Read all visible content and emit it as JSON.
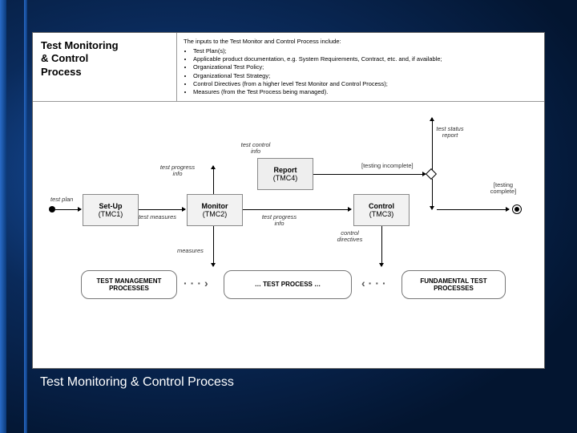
{
  "title": "Test Monitoring\n& Control\nProcess",
  "caption": "Test Monitoring & Control Process",
  "inputs": {
    "lead": "The inputs to the Test Monitor and Control Process include:",
    "items": [
      "Test Plan(s);",
      "Applicable product documentation, e.g. System Requirements, Contract, etc. and, if available;",
      "Organizational Test Policy;",
      "Organizational Test Strategy;",
      "Control Directives (from a higher level Test Monitor and Control Process);",
      "Measures (from the Test Process being managed)."
    ]
  },
  "nodes": {
    "setup": {
      "name": "Set-Up",
      "code": "(TMC1)"
    },
    "monitor": {
      "name": "Monitor",
      "code": "(TMC2)"
    },
    "report": {
      "name": "Report",
      "code": "(TMC4)"
    },
    "control": {
      "name": "Control",
      "code": "(TMC3)"
    }
  },
  "labels": {
    "test_plan": "test plan",
    "test_measures": "test measures",
    "test_progress_info_1": "test progress info",
    "test_control_info": "test control info",
    "test_progress_info_2": "test progress info",
    "test_status_report": "test status report",
    "testing_incomplete": "[testing incomplete]",
    "testing_complete": "[testing complete]",
    "measures": "measures",
    "control_directives": "control directives"
  },
  "rboxes": {
    "tmp": "TEST MANAGEMENT PROCESSES",
    "tp": "… TEST PROCESS …",
    "ftp": "FUNDAMENTAL TEST PROCESSES"
  }
}
